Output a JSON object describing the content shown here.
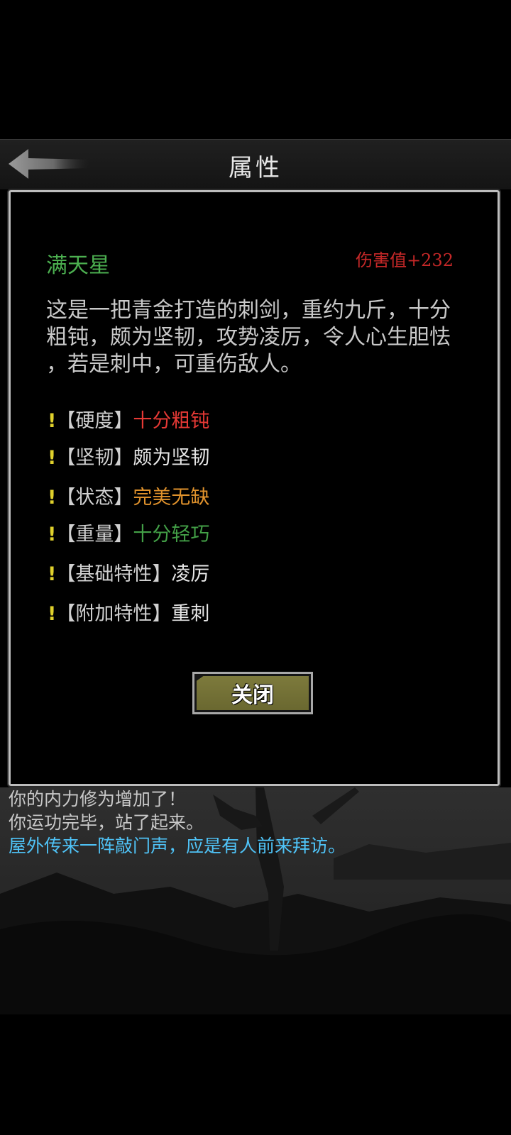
{
  "header": {
    "title": "属性",
    "back_icon": "back-arrow-icon"
  },
  "item": {
    "name": "满天星",
    "name_color": "#4caf50",
    "damage": "伤害值+232",
    "damage_color": "#c62828",
    "description": "这是一把青金打造的刺剑，重约九斤，十分\n粗钝，颇为坚韧，攻势凌厉，令人心生胆怯\n，若是刺中，可重伤敌人。"
  },
  "attributes": [
    {
      "label": "【硬度】",
      "value": "十分粗钝",
      "color": "#e53935"
    },
    {
      "label": "【坚韧】",
      "value": "颇为坚韧",
      "color": "#e6e6e6"
    },
    {
      "label": "【状态】",
      "value": "完美无缺",
      "color": "#e0922c"
    },
    {
      "label": "【重量】",
      "value": "十分轻巧",
      "color": "#43a047"
    },
    {
      "label": "【基础特性】",
      "value": "凌厉",
      "color": "#e6e6e6"
    },
    {
      "label": "【附加特性】",
      "value": "重刺",
      "color": "#e6e6e6"
    }
  ],
  "attribute_marker": "!",
  "close_button": {
    "label": "关闭"
  },
  "log": [
    {
      "text": "你的内力修为增加了！",
      "color": "#c8c8c8"
    },
    {
      "text": "你运功完毕，站了起来。",
      "color": "#c8c8c8"
    },
    {
      "text": "屋外传来一阵敲门声，应是有人前来拜访。",
      "color": "#4fc3f7"
    }
  ]
}
